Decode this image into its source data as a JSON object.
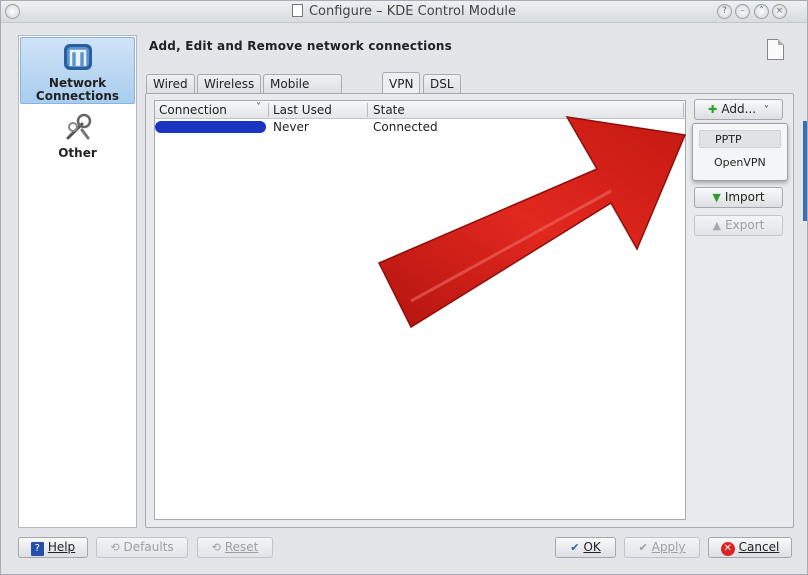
{
  "window": {
    "title": "Configure – KDE Control Module"
  },
  "sidebar": {
    "items": [
      {
        "label": "Network\nConnections",
        "line1": "Network",
        "line2": "Connections"
      },
      {
        "label": "Other"
      }
    ]
  },
  "header": {
    "title": "Add, Edit and Remove network connections"
  },
  "tabs": [
    {
      "label": "Wired"
    },
    {
      "label": "Wireless"
    },
    {
      "label": "Mobile Broadband"
    },
    {
      "label": "VPN",
      "active": true
    },
    {
      "label": "DSL"
    }
  ],
  "table": {
    "columns": [
      "Connection",
      "Last Used",
      "State"
    ],
    "rows": [
      {
        "connection": "",
        "last_used": "Never",
        "state": "Connected"
      }
    ]
  },
  "actions": {
    "add": "Add...",
    "import": "Import",
    "export": "Export"
  },
  "add_menu": {
    "items": [
      "PPTP",
      "OpenVPN"
    ],
    "highlighted": "PPTP"
  },
  "footer": {
    "help": "Help",
    "defaults": "Defaults",
    "reset": "Reset",
    "ok": "OK",
    "apply": "Apply",
    "cancel": "Cancel"
  },
  "colors": {
    "annotation_arrow": "#d8201a",
    "redaction": "#1a36c0",
    "selection": "#a9cdef"
  }
}
